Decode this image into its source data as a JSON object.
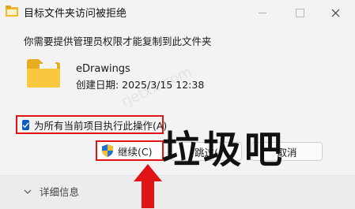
{
  "window": {
    "title": "目标文件夹访问被拒绝"
  },
  "message": "你需要提供管理员权限才能复制到此文件夹",
  "file": {
    "name": "eDrawings",
    "date": "创建日期: 2025/3/15 12:38"
  },
  "checkbox": {
    "label": "为所有当前项目执行此操作(A)",
    "checked": true
  },
  "buttons": {
    "continue": "继续(C)",
    "skip": "跳过(",
    "cancel": "取消"
  },
  "overlay": {
    "text": "垃圾吧"
  },
  "footer": {
    "details": "详细信息"
  },
  "watermark": {
    "text": "rjetxx.com"
  },
  "colors": {
    "highlight": "#e01414",
    "accent": "#0a5cc2",
    "folder": "#f5c542"
  },
  "icons": [
    "folder-icon",
    "app-icon",
    "shield-icon",
    "checkmark-icon",
    "chevron-down-icon",
    "close-icon",
    "arrow-up-icon"
  ]
}
